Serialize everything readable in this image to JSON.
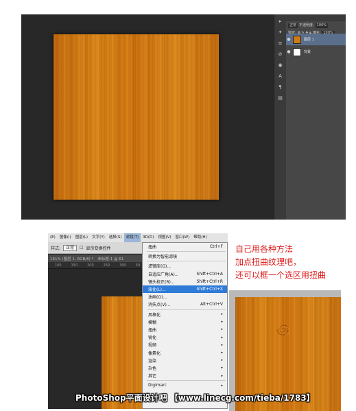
{
  "top_screenshot": {
    "tools": [
      "▸",
      "✦",
      "≡",
      "⊘",
      "◉",
      "A",
      "¶",
      "▤"
    ],
    "layers_panel": {
      "kind_select": "正常",
      "opacity_label": "不透明度:",
      "opacity_value": "100%",
      "lock_label": "锁定:",
      "fill_label": "填充:",
      "fill_value": "100%",
      "layers": [
        {
          "name": "图层 1",
          "thumb_color": "#d07a14",
          "selected": true
        },
        {
          "name": "背景",
          "thumb_color": "#ffffff",
          "selected": false
        }
      ]
    }
  },
  "bottom_screenshot": {
    "menubar": [
      "图像(I)",
      "图层(L)",
      "文字(Y)",
      "选择(S)",
      "滤镜(T)",
      "3D(D)",
      "视图(V)",
      "窗口(W)",
      "帮助(H)"
    ],
    "menubar_left": "(E)",
    "active_menu": "滤镜(T)",
    "options": {
      "label": "样式:",
      "mode_value": "正常",
      "checkbox_label": "显示变换控件"
    },
    "doc_tabs": [
      "161% (图层 1, RGB/8) *",
      "未标题-1 @ 61"
    ],
    "ruler_numbers": [
      "100",
      "150",
      "200",
      "250",
      "300",
      "50"
    ],
    "filter_menu": {
      "top_item": {
        "label": "扭曲",
        "shortcut": "Ctrl+F"
      },
      "items_group1": [
        {
          "label": "转换为智能滤镜",
          "shortcut": ""
        }
      ],
      "items_group2": [
        {
          "label": "滤镜库(G)...",
          "shortcut": ""
        },
        {
          "label": "自适应广角(A)...",
          "shortcut": "Shift+Ctrl+A"
        },
        {
          "label": "镜头校正(R)...",
          "shortcut": "Shift+Ctrl+R"
        },
        {
          "label": "液化(L)...",
          "shortcut": "Shift+Ctrl+X",
          "highlight": true
        },
        {
          "label": "油画(O)...",
          "shortcut": ""
        },
        {
          "label": "消失点(V)...",
          "shortcut": "Alt+Ctrl+V"
        }
      ],
      "items_group3": [
        {
          "label": "风格化",
          "shortcut": "▸"
        },
        {
          "label": "模糊",
          "shortcut": "▸"
        },
        {
          "label": "扭曲",
          "shortcut": "▸"
        },
        {
          "label": "锐化",
          "shortcut": "▸"
        },
        {
          "label": "视频",
          "shortcut": "▸"
        },
        {
          "label": "像素化",
          "shortcut": "▸"
        },
        {
          "label": "渲染",
          "shortcut": "▸"
        },
        {
          "label": "杂色",
          "shortcut": "▸"
        },
        {
          "label": "其它",
          "shortcut": "▸"
        }
      ],
      "bottom_item": "Digimarc"
    }
  },
  "annotation": {
    "lines": [
      "自己用各种方法",
      "加点扭曲纹理吧，",
      "还可以框一个选区用扭曲"
    ],
    "color": "#e01919"
  },
  "watermark": "PhotoShop平面设计吧 【www.linecg.com/tieba/1783】"
}
